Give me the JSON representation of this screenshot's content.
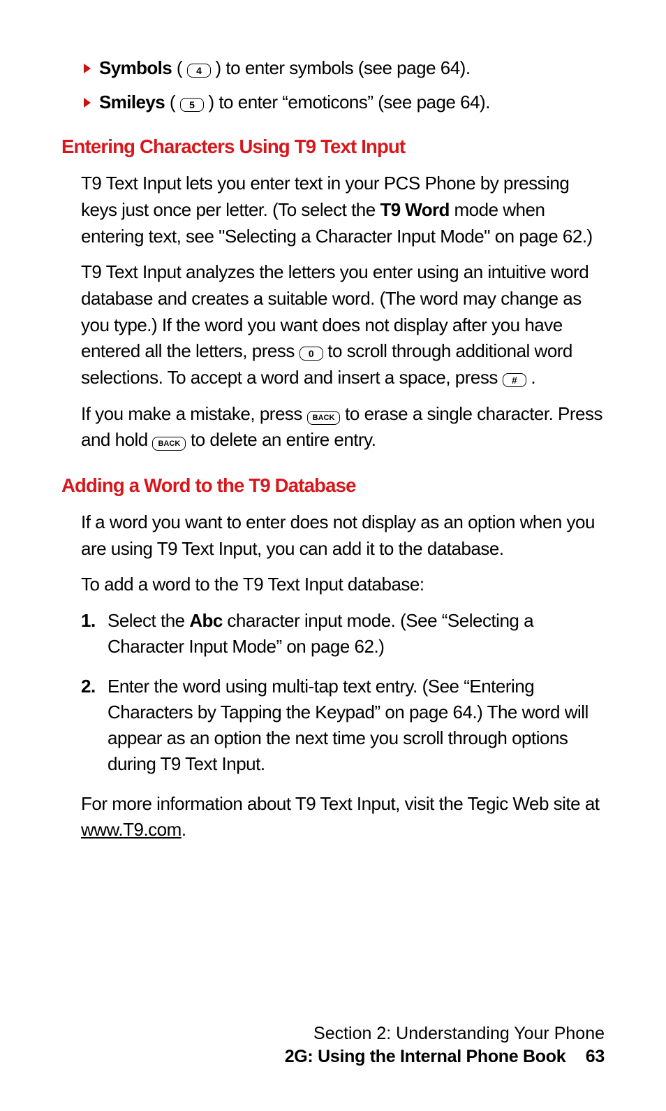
{
  "bullets": [
    {
      "label": "Symbols",
      "key": "4",
      "rest": " ) to enter symbols (see page 64)."
    },
    {
      "label": "Smileys",
      "key": "5",
      "rest": " ) to enter “emoticons” (see page 64)."
    }
  ],
  "h1": "Entering Characters Using T9 Text Input",
  "p1a": "T9 Text Input lets you enter text in your PCS Phone by pressing keys just once per letter. (To select the ",
  "p1b": "T9 Word",
  "p1c": " mode when entering text, see \"Selecting a Character Input Mode\" on page 62.)",
  "p2a": "T9 Text Input analyzes the letters you enter using an intuitive word database and creates a suitable word. (The word may change as you type.) If the word you want does not display after you have entered all the letters, press ",
  "p2key1": "0",
  "p2b": " to scroll through additional word selections. To accept a word and insert a space, press ",
  "p2key2": "#",
  "p2c": " .",
  "p3a": "If you make a mistake, press ",
  "p3key1": "BACK",
  "p3b": " to erase a single character. Press and hold ",
  "p3key2": "BACK",
  "p3c": " to delete an entire entry.",
  "h2": "Adding a Word to the T9 Database",
  "p4": "If a word you want to enter does not display as an option when you are using T9 Text Input, you can add it to the database.",
  "p5": "To add a word to the T9 Text Input database:",
  "steps": {
    "n1": "1.",
    "s1a": "Select the ",
    "s1b": "Abc",
    "s1c": " character input mode. (See “Selecting a Character Input Mode” on page 62.)",
    "n2": "2.",
    "s2": "Enter the word using multi-tap text entry. (See “Entering Characters by Tapping the Keypad” on page 64.) The word will appear as an option the next time you scroll through options during T9 Text Input."
  },
  "p6a": "For more information about T9 Text Input, visit the Tegic Web site at ",
  "p6link": "www.T9.com",
  "p6b": ".",
  "footer": {
    "section": "Section 2: Understanding Your Phone",
    "sub": "2G: Using the Internal Phone Book",
    "page": "63"
  }
}
